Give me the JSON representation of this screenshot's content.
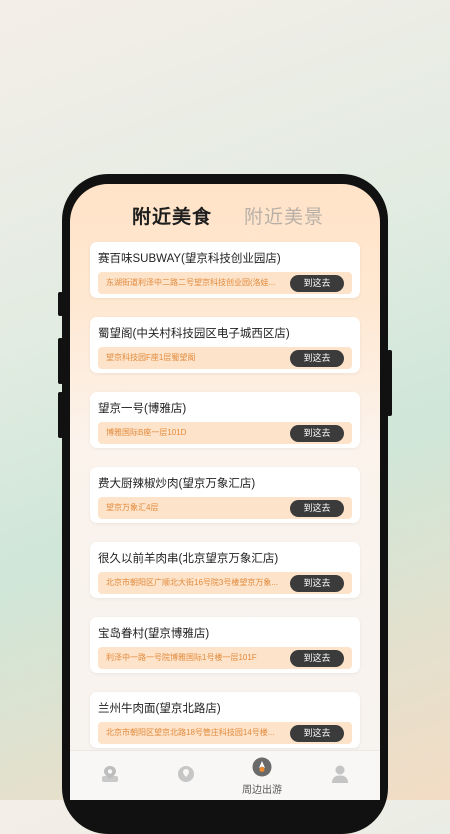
{
  "tabs": [
    {
      "label": "附近美食",
      "active": true
    },
    {
      "label": "附近美景",
      "active": false
    }
  ],
  "items": [
    {
      "name": "赛百味SUBWAY(望京科技创业园店)",
      "address": "东湖街道利泽中二路二号望京科技创业园(洛娃...",
      "button": "到这去"
    },
    {
      "name": "蜀望阁(中关村科技园区电子城西区店)",
      "address": "望京科技园F座1层蜀望阁",
      "button": "到这去"
    },
    {
      "name": "望京一号(博雅店)",
      "address": "博雅国际B座一层101D",
      "button": "到这去"
    },
    {
      "name": "费大厨辣椒炒肉(望京万象汇店)",
      "address": "望京万象汇4层",
      "button": "到这去"
    },
    {
      "name": "很久以前羊肉串(北京望京万象汇店)",
      "address": "北京市朝阳区广顺北大街16号院3号楼望京万象...",
      "button": "到这去"
    },
    {
      "name": "宝岛眷村(望京博雅店)",
      "address": "利泽中一路一号院博雅国际1号楼一层101F",
      "button": "到这去"
    },
    {
      "name": "兰州牛肉面(望京北路店)",
      "address": "北京市朝阳区望京北路18号管庄科技园14号楼...",
      "button": "到这去"
    }
  ],
  "nav": [
    {
      "label": "",
      "icon": "map-pin-icon"
    },
    {
      "label": "",
      "icon": "location-icon"
    },
    {
      "label": "周边出游",
      "icon": "compass-icon"
    },
    {
      "label": "",
      "icon": "person-icon"
    }
  ],
  "colors": {
    "accent": "#f08a2c",
    "button": "#3b3b3b",
    "address_bg": "#fde3c9",
    "address_text": "#e28a3c"
  }
}
